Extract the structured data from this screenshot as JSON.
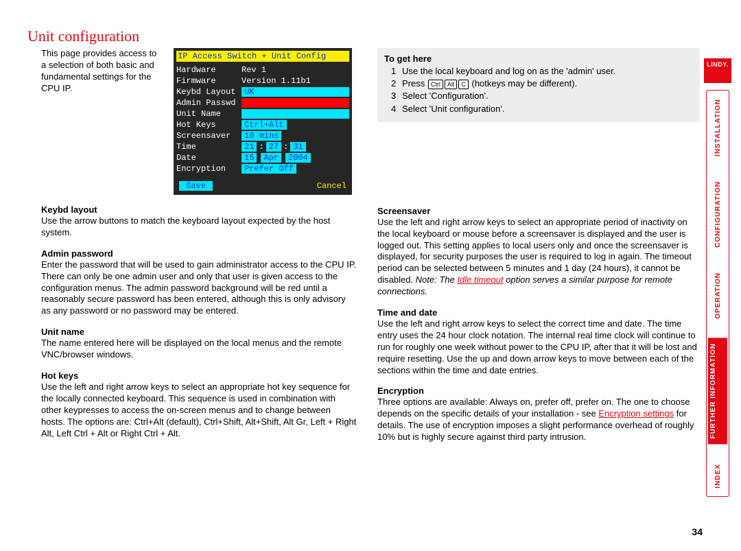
{
  "page": {
    "title": "Unit configuration",
    "number": "34"
  },
  "intro": "This page provides access to a selection of both basic and fundamental settings for the CPU IP.",
  "config": {
    "title": "IP Access Switch + Unit Config",
    "rows": {
      "hardware_l": "Hardware",
      "hardware_v": "Rev 1",
      "firmware_l": "Firmware",
      "firmware_v": "Version 1.11b1",
      "keybd_l": "Keybd Layout",
      "keybd_v": "UK",
      "admin_l": "Admin Passwd",
      "unit_l": "Unit Name",
      "hotkeys_l": "Hot Keys",
      "hotkeys_v": "Ctrl+Alt",
      "screensaver_l": "Screensaver",
      "screensaver_v": "10 mins",
      "time_l": "Time",
      "time_h": "21",
      "time_m": "27",
      "time_s": "31",
      "date_l": "Date",
      "date_d": "15",
      "date_mo": "Apr",
      "date_y": "2004",
      "enc_l": "Encryption",
      "enc_v": "Prefer Off"
    },
    "save": "Save",
    "cancel": "Cancel"
  },
  "togethere": {
    "heading": "To get here",
    "s1": "Use the local keyboard and log on as the 'admin' user.",
    "s2a": "Press",
    "s2b": "(hotkeys may be different).",
    "k1": "Ctrl",
    "k2": "Alt",
    "k3": "C",
    "s3": "Select 'Configuration'.",
    "s4": "Select 'Unit configuration'."
  },
  "left": {
    "h1": "Keybd layout",
    "p1": "Use the arrow buttons to match the keyboard layout expected by the host system.",
    "h2": "Admin password",
    "p2": "Enter the password that will be used to gain administrator access to the CPU IP. There can only be one admin user and only that user is given access to the configuration menus. The admin password background will be red until a reasonably secure password has been entered, although this is only advisory as any password or no password may be entered.",
    "h3": "Unit name",
    "p3": "The name entered here will be displayed on the local menus and the remote VNC/browser windows.",
    "h4": "Hot keys",
    "p4": "Use the left and right arrow keys to select an appropriate hot key sequence for the locally connected keyboard. This sequence is used in combination with other keypresses to access the on-screen menus and to change between hosts. The options are: Ctrl+Alt (default), Ctrl+Shift, Alt+Shift, Alt Gr, Left + Right Alt, Left Ctrl + Alt or Right Ctrl + Alt."
  },
  "right": {
    "h1": "Screensaver",
    "p1a": "Use the left and right arrow keys to select an appropriate period of inactivity on the local keyboard or mouse before a screensaver is displayed and the user is logged out. This setting applies to local users only and once the screensaver is displayed, for security purposes the user is required to log in again. The timeout period can be selected between 5 minutes and 1 day (24 hours), it cannot be disabled. ",
    "p1note_a": "Note: The ",
    "p1note_link": "Idle timeout",
    "p1note_b": " option serves a similar purpose for remote connections.",
    "h2": "Time and date",
    "p2": "Use the left and right arrow keys to select the correct time and date. The time entry uses the 24 hour clock notation. The internal real time clock will continue to run for roughly one week without power to the CPU IP, after that it will be lost and require resetting. Use the up and down arrow keys to move between each of the sections within the time and date entries.",
    "h3": "Encryption",
    "p3a": "Three options are available: Always on, prefer off, prefer on. The one to choose depends on the specific details of your installation - see ",
    "p3link": "Encryption settings",
    "p3b": " for details. The use of encryption imposes a slight performance overhead of roughly 10% but is highly secure against third party intrusion."
  },
  "sidebar": {
    "logo": "LINDY.",
    "tabs": {
      "inst": "INSTALLATION",
      "conf": "CONFIGURATION",
      "oper": "OPERATION",
      "info": "FURTHER\nINFORMATION",
      "index": "INDEX"
    }
  }
}
